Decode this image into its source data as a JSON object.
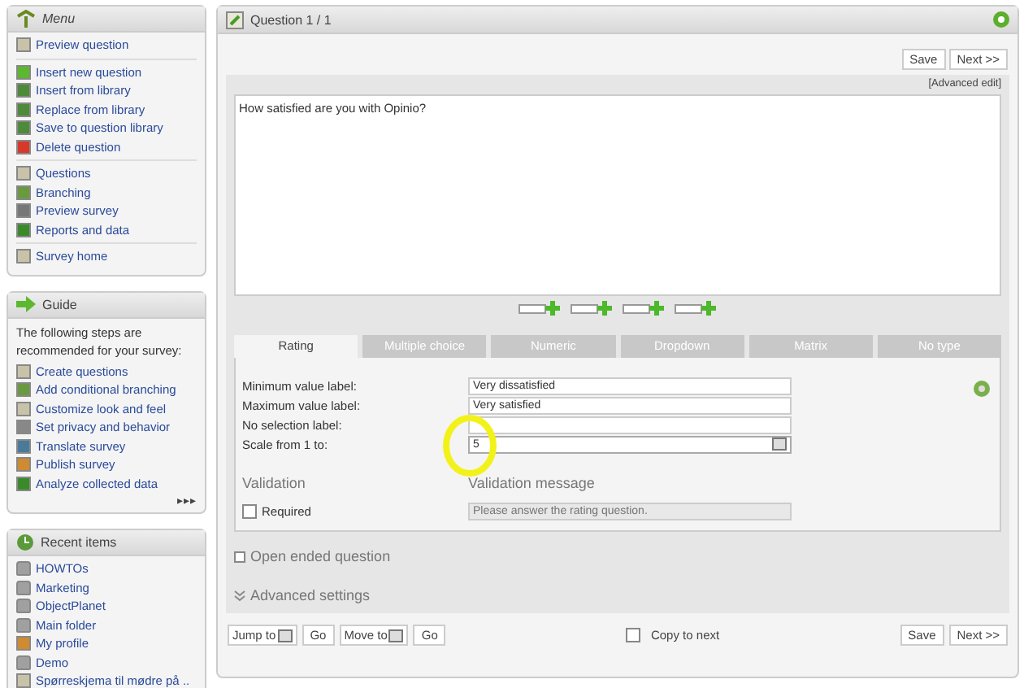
{
  "menu": {
    "title": "Menu",
    "groups": [
      [
        {
          "label": "Preview question",
          "kind": "page"
        }
      ],
      [
        {
          "label": "Insert new question",
          "kind": "add"
        },
        {
          "label": "Insert from library",
          "kind": "library"
        },
        {
          "label": "Replace from library",
          "kind": "library"
        },
        {
          "label": "Save to question library",
          "kind": "library"
        },
        {
          "label": "Delete question",
          "kind": "delete"
        }
      ],
      [
        {
          "label": "Questions",
          "kind": "page"
        },
        {
          "label": "Branching",
          "kind": "branch"
        },
        {
          "label": "Preview survey",
          "kind": "eye"
        },
        {
          "label": "Reports and data",
          "kind": "chart"
        }
      ],
      [
        {
          "label": "Survey home",
          "kind": "page"
        }
      ]
    ]
  },
  "guide": {
    "title": "Guide",
    "intro": "The following steps are recommended for your survey:",
    "items": [
      {
        "label": "Create questions",
        "kind": "page"
      },
      {
        "label": "Add conditional branching",
        "kind": "branch"
      },
      {
        "label": "Customize look and feel",
        "kind": "page"
      },
      {
        "label": "Set privacy and behavior",
        "kind": "gear"
      },
      {
        "label": "Translate survey",
        "kind": "globe"
      },
      {
        "label": "Publish survey",
        "kind": "person"
      },
      {
        "label": "Analyze collected data",
        "kind": "chart"
      }
    ],
    "more": "▸▸▸"
  },
  "recent": {
    "title": "Recent items",
    "items": [
      {
        "label": "HOWTOs",
        "kind": "folder"
      },
      {
        "label": "Marketing",
        "kind": "folder"
      },
      {
        "label": "ObjectPlanet",
        "kind": "folder"
      },
      {
        "label": "Main folder",
        "kind": "folder"
      },
      {
        "label": "My profile",
        "kind": "person"
      },
      {
        "label": "Demo",
        "kind": "folder"
      },
      {
        "label": "Spørreskjema til mødre på ..",
        "kind": "page"
      }
    ]
  },
  "question": {
    "title": "Question 1 / 1",
    "top_buttons": [
      "Save",
      "Next >>"
    ],
    "advanced_edit": "[Advanced edit]",
    "text": "How satisfied are you with Opinio?",
    "tabs": [
      {
        "label": "Rating",
        "selected": true
      },
      {
        "label": "Multiple choice",
        "selected": false
      },
      {
        "label": "Numeric",
        "selected": false
      },
      {
        "label": "Dropdown",
        "selected": false
      },
      {
        "label": "Matrix",
        "selected": false
      },
      {
        "label": "No type",
        "selected": false
      }
    ],
    "fields": [
      {
        "label": "Minimum value label:",
        "value": "Very dissatisfied",
        "kind": "text"
      },
      {
        "label": "Maximum value label:",
        "value": "Very satisfied",
        "kind": "text"
      },
      {
        "label": "No selection label:",
        "kind": "text"
      },
      {
        "label": "Scale from 1 to:",
        "value": "5",
        "kind": "select"
      }
    ],
    "validation": {
      "heading": "Validation",
      "message_heading": "Validation message",
      "required": {
        "label": "Required",
        "checked": false
      },
      "placeholder": "Please answer the rating question."
    },
    "open_ended": {
      "label": "Open ended question",
      "checked": false
    },
    "advanced_settings": "Advanced settings",
    "footer": {
      "jump": "Jump to",
      "go": "Go",
      "move": "Move to",
      "go2": "Go",
      "copy": {
        "label": "Copy to next",
        "checked": false
      },
      "buttons": [
        "Save",
        "Next >>"
      ]
    }
  }
}
